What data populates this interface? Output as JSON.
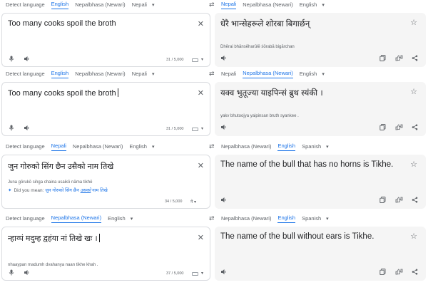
{
  "rows": [
    {
      "source_langs": [
        "Detect language",
        "English",
        "Nepalbhasa (Newari)",
        "Nepali"
      ],
      "source_active": 1,
      "target_langs": [
        "Nepali",
        "Nepalbhasa (Newari)",
        "English"
      ],
      "target_active": 0,
      "source_text": "Too many cooks spoil the broth",
      "source_translit": "",
      "char_count": "31 / 5,000",
      "target_text": "धेरै भान्सेहरूले शोरबा बिगार्छन्",
      "target_translit": "Dhērai bhānsēharūlē śōrabā bigārchan"
    },
    {
      "source_langs": [
        "Detect language",
        "English",
        "Nepalbhasa (Newari)",
        "Nepali"
      ],
      "source_active": 1,
      "target_langs": [
        "Nepali",
        "Nepalbhasa (Newari)",
        "English"
      ],
      "target_active": 1,
      "source_text": "Too many cooks spoil the broth",
      "source_translit": "",
      "char_count": "31 / 5,000",
      "target_text": "यक्व भुतूज्या याइपिन्सं ब्रुथ स्यंकी ।",
      "target_translit": "yakv bhutoojya yaipinsan bruth syankee ."
    },
    {
      "source_langs": [
        "Detect language",
        "Nepali",
        "Nepalbhasa (Newari)",
        "English"
      ],
      "source_active": 1,
      "target_langs": [
        "Nepalbhasa (Newari)",
        "English",
        "Spanish"
      ],
      "target_active": 1,
      "source_text": "जुन गोरुको सिंग छैन उसैको नाम तिखे",
      "source_translit": "Juna gōrukō siṅga chaina usaikō nāma tikhē",
      "did_you_mean_label": "Did you mean:",
      "did_you_mean_pre": "जुन गोरुको सिंग छैन ",
      "did_you_mean_em": "उसको",
      "did_you_mean_post": " नाम तिखे",
      "char_count": "34 / 5,000",
      "target_text": "The name of the bull that has no horns is Tikhe.",
      "target_translit": ""
    },
    {
      "source_langs": [
        "Detect language",
        "Nepalbhasa (Newari)",
        "English"
      ],
      "source_active": 1,
      "target_langs": [
        "Nepalbhasa (Newari)",
        "English",
        "Spanish"
      ],
      "target_active": 1,
      "source_text": "न्हाय्पं मदुम्ह द्वहंया नां तिखे खः ।",
      "source_translit": "nhaaypan madumh dvahanya naan tikhe khah .",
      "char_count": "37 / 5,000",
      "target_text": "The name of the bull without ears is Tikhe.",
      "target_translit": ""
    }
  ],
  "icons": {
    "swap": "⇄",
    "close": "✕",
    "star": "☆",
    "mic": "mic-icon",
    "speaker": "speaker-icon",
    "copy": "copy-icon",
    "feedback": "thumbs-icon",
    "share": "share-icon",
    "dropdown": "chevron-down-icon",
    "sparkle": "✦"
  },
  "colors": {
    "accent": "#1a73e8",
    "muted": "#5f6368",
    "target_bg": "#f5f5f5"
  }
}
